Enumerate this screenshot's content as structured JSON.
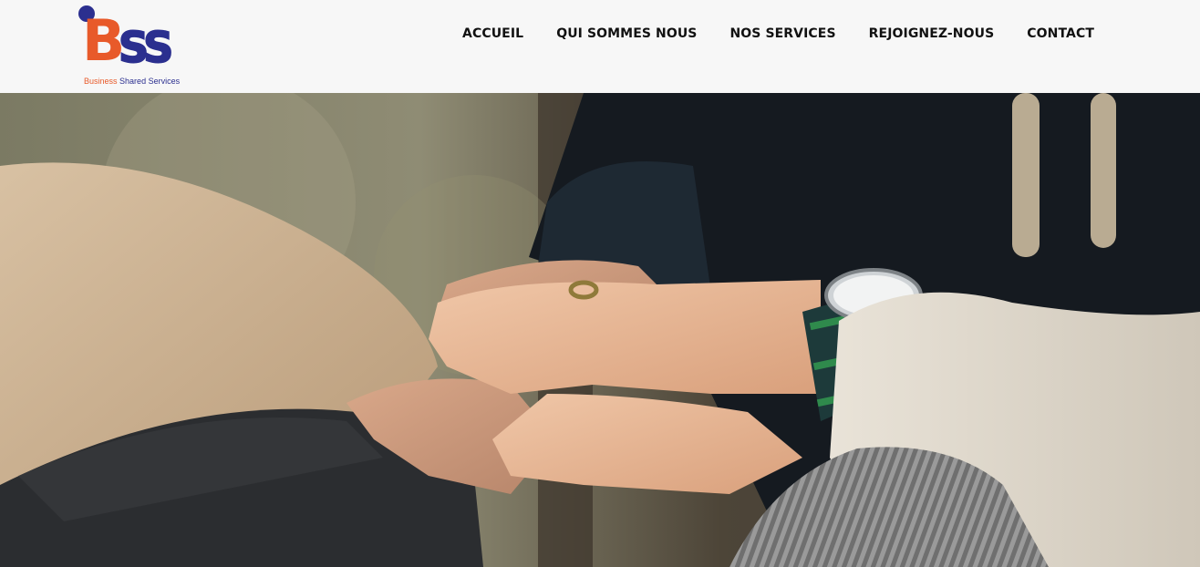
{
  "brand": {
    "logo_letter_b": "B",
    "logo_letters_ss": "SS",
    "tagline_part1": "Business",
    "tagline_part2": "Shared Services",
    "colors": {
      "orange": "#e85a2a",
      "navy": "#2b2f8f"
    }
  },
  "nav": {
    "items": [
      {
        "label": "ACCUEIL"
      },
      {
        "label": "QUI SOMMES NOUS"
      },
      {
        "label": "NOS SERVICES"
      },
      {
        "label": "REJOIGNEZ-NOUS"
      },
      {
        "label": "CONTACT"
      }
    ]
  },
  "hero": {
    "image": "team-hands-stacked-photo"
  }
}
